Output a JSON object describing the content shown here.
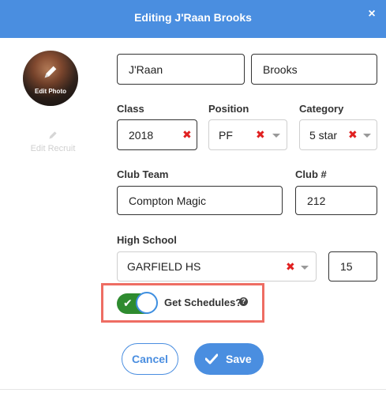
{
  "header": {
    "title": "Editing J'Raan Brooks",
    "close": "×"
  },
  "avatar": {
    "label": "Edit Photo"
  },
  "sidebar": {
    "edit_recruit": "Edit Recruit"
  },
  "name": {
    "first": "J'Raan",
    "last": "Brooks"
  },
  "labels": {
    "class": "Class",
    "position": "Position",
    "category": "Category",
    "club_team": "Club Team",
    "club_number": "Club #",
    "high_school": "High School"
  },
  "fields": {
    "class": "2018",
    "position": "PF",
    "category": "5 star",
    "club_team": "Compton Magic",
    "club_number": "212",
    "high_school": "GARFIELD HS",
    "hs_number": "15"
  },
  "toggle": {
    "label": "Get Schedules?",
    "enabled": true
  },
  "buttons": {
    "cancel": "Cancel",
    "save": "Save"
  },
  "colors": {
    "accent": "#4a8ee0",
    "toggle_on": "#2e8b2f",
    "clear_x": "#e02020",
    "highlight": "#ee6d63"
  }
}
